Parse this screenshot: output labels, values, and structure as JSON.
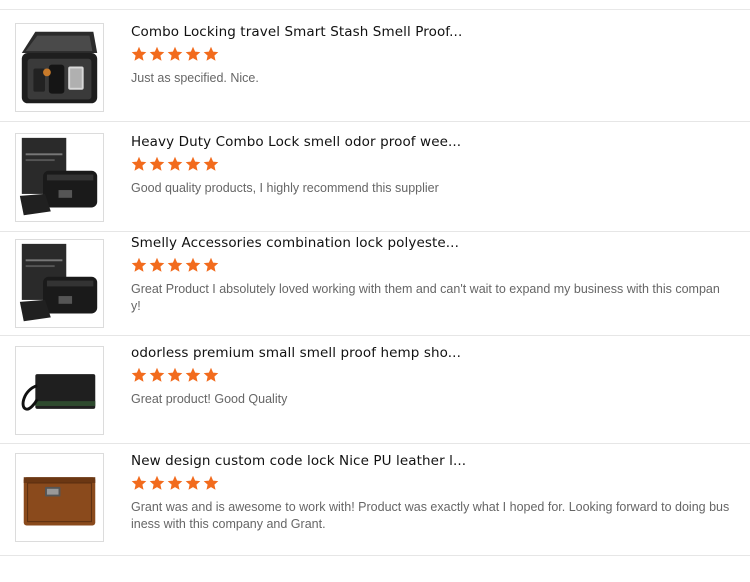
{
  "colors": {
    "star": "#f26b1d",
    "title": "#111111",
    "comment": "#666666",
    "divider": "#e6e6e6"
  },
  "reviews": [
    {
      "product_title": "Combo Locking travel Smart Stash Smell Proof...",
      "rating": 5,
      "comment": "Just as specified. Nice.",
      "image": "black-travel-case-with-accessories"
    },
    {
      "product_title": "Heavy Duty Combo Lock smell odor proof wee...",
      "rating": 5,
      "comment": "Good quality products, I highly recommend this supplier",
      "image": "black-box-and-lock-case"
    },
    {
      "product_title": "Smelly Accessories combination lock polyeste...",
      "rating": 5,
      "comment": "Great Product I absolutely loved working with them and can't wait to expand my business with this company!",
      "image": "black-box-and-lock-case"
    },
    {
      "product_title": "odorless premium small smell proof hemp sho...",
      "rating": 5,
      "comment": "Great product! Good Quality",
      "image": "black-wristlet-pouch"
    },
    {
      "product_title": "New design custom code lock Nice PU leather l...",
      "rating": 5,
      "comment": "Grant was and is awesome to work with! Product was exactly what I hoped for. Looking forward to doing business with this company and Grant.",
      "image": "brown-leather-lock-pouch"
    }
  ]
}
